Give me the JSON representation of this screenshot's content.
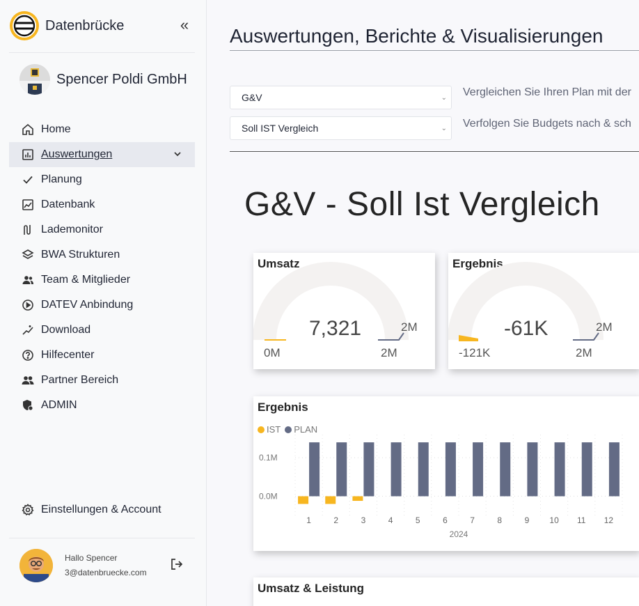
{
  "brand": {
    "name": "Datenbrücke"
  },
  "company": {
    "name": "Spencer Poldi GmbH"
  },
  "nav": [
    {
      "label": "Home",
      "icon": "home-icon"
    },
    {
      "label": "Auswertungen",
      "icon": "chart-bar-icon",
      "active": true
    },
    {
      "label": "Planung",
      "icon": "check-icon"
    },
    {
      "label": "Datenbank",
      "icon": "database-chart-icon"
    },
    {
      "label": "Lademonitor",
      "icon": "route-icon"
    },
    {
      "label": "BWA Strukturen",
      "icon": "layers-icon"
    },
    {
      "label": "Team & Mitglieder",
      "icon": "team-icon"
    },
    {
      "label": "DATEV Anbindung",
      "icon": "play-circle-icon"
    },
    {
      "label": "Download",
      "icon": "sparkle-chart-icon"
    },
    {
      "label": "Hilfecenter",
      "icon": "help-circle-icon"
    },
    {
      "label": "Partner Bereich",
      "icon": "partner-icon"
    },
    {
      "label": "ADMIN",
      "icon": "shield-admin-icon"
    }
  ],
  "settings": {
    "label": "Einstellungen & Account",
    "icon": "gear-icon"
  },
  "user": {
    "greeting": "Hallo Spencer",
    "email": "3@datenbruecke.com"
  },
  "main": {
    "title": "Auswertungen, Berichte & Visualisierungen",
    "filters": [
      {
        "value": "G&V",
        "hint": "Vergleichen Sie Ihren Plan mit der"
      },
      {
        "value": "Soll IST Vergleich",
        "hint": "Verfolgen Sie Budgets nach & sch"
      }
    ],
    "report_title": "G&V - Soll Ist Vergleich"
  },
  "gauges": [
    {
      "title": "Umsatz",
      "value": "7,321",
      "min": "0M",
      "max": "2M",
      "target": "2M",
      "fill_fraction": 0.0
    },
    {
      "title": "Ergebnis",
      "value": "-61K",
      "min": "-121K",
      "max": "2M",
      "target": "2M",
      "fill_fraction": 0.03
    }
  ],
  "colors": {
    "ist": "#F7B620",
    "plan": "#636B85",
    "gauge_bg": "#F4F2F1"
  },
  "chart_data": {
    "type": "bar",
    "title": "Ergebnis",
    "series": [
      {
        "name": "IST",
        "values": [
          -0.02,
          -0.02,
          -0.012,
          null,
          null,
          null,
          null,
          null,
          null,
          null,
          null,
          null
        ]
      },
      {
        "name": "PLAN",
        "values": [
          0.14,
          0.14,
          0.14,
          0.14,
          0.14,
          0.14,
          0.14,
          0.14,
          0.14,
          0.14,
          0.14,
          0.14
        ]
      }
    ],
    "categories": [
      "1",
      "2",
      "3",
      "4",
      "5",
      "6",
      "7",
      "8",
      "9",
      "10",
      "11",
      "12"
    ],
    "xlabel": "2024",
    "ylabel": "",
    "y_ticks": [
      "0.0M",
      "0.1M"
    ],
    "ylim": [
      -0.03,
      0.16
    ],
    "legend": "top-left",
    "unit": "M"
  },
  "next_card": {
    "title": "Umsatz & Leistung"
  }
}
